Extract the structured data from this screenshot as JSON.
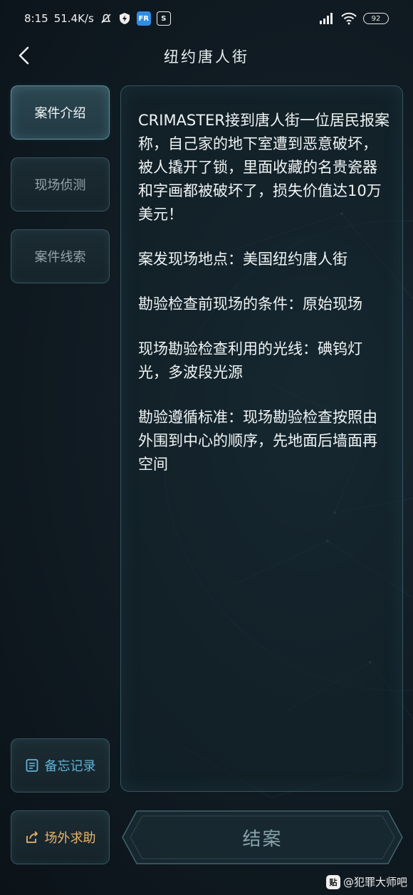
{
  "status_bar": {
    "time": "8:15",
    "net_speed": "51.4K/s",
    "app_badge_1": "FR",
    "app_badge_2": "S",
    "battery": "92"
  },
  "header": {
    "title": "纽约唐人街"
  },
  "sidebar": {
    "items": [
      {
        "label": "案件介绍",
        "active": true
      },
      {
        "label": "现场侦测",
        "active": false
      },
      {
        "label": "案件线索",
        "active": false
      }
    ],
    "memo_label": "备忘记录",
    "help_label": "场外求助"
  },
  "content": {
    "paragraphs": [
      "CRIMASTER接到唐人街一位居民报案称，自己家的地下室遭到恶意破坏，被人撬开了锁，里面收藏的名贵瓷器和字画都被破坏了，损失价值达10万美元！",
      "案发现场地点：美国纽约唐人街",
      "勘验检查前现场的条件：原始现场",
      "现场勘验检查利用的光线：碘钨灯光，多波段光源",
      "勘验遵循标准：现场勘验检查按照由外围到中心的顺序，先地面后墙面再空间"
    ]
  },
  "footer": {
    "close_case_label": "结案"
  },
  "watermark": {
    "logo": "贴",
    "text": "@犯罪大师吧"
  },
  "colors": {
    "background": "#111c24",
    "active_tab": "#2b4650",
    "memo_accent": "#5fb3d8",
    "help_accent": "#e9b46a",
    "close_case_text": "#86a2aa"
  }
}
